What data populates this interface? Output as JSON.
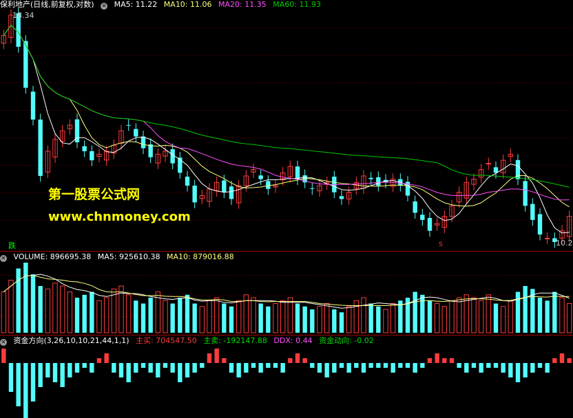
{
  "price_panel": {
    "title": "保利地产(日线,前复权,对数)",
    "ma5_label": "MA5: 11.22",
    "ma10_label": "MA10: 11.06",
    "ma20_label": "MA20: 11.35",
    "ma60_label": "MA60: 11.93",
    "high_label": "18.34",
    "low_label": "10.2",
    "die_label": "跌",
    "s_mark": "S"
  },
  "volume_panel": {
    "volume_label": "VOLUME: 896695.38",
    "ma5_label": "MA5: 925610.38",
    "ma10_label": "MA10: 879016.88"
  },
  "fund_panel": {
    "name_label": "资金方向(3,26,10,10,21,44,1,1)",
    "buy_label": "主买: 704547.50",
    "sell_label": "主卖: -192147.88",
    "ddx_label": "DDX: 0.44",
    "flow_label": "资金动向: -0.02"
  },
  "watermark": {
    "line1": "第一股票公式网",
    "line2": "www.chnmoney.com"
  },
  "colors": {
    "up": "#ff3c3c",
    "down": "#54fcfc",
    "ma5": "#ffffff",
    "ma10": "#ffff80",
    "ma20": "#ff50ff",
    "ma60": "#00cc00",
    "grid": "#7a0000",
    "watermark": "#ffff00"
  },
  "chart_data": {
    "type": "candlestick",
    "ohlc_close": [
      17.4,
      18.34,
      16.9,
      15.2,
      14.0,
      12.1,
      12.9,
      13.3,
      13.6,
      13.8,
      13.2,
      12.9,
      12.6,
      12.8,
      12.9,
      13.1,
      13.6,
      13.8,
      13.4,
      13.0,
      12.7,
      12.8,
      12.9,
      12.5,
      12.2,
      11.8,
      11.3,
      11.5,
      11.7,
      11.9,
      11.6,
      11.4,
      11.8,
      12.1,
      12.3,
      12.0,
      11.7,
      11.8,
      12.2,
      12.4,
      12.0,
      11.9,
      11.7,
      11.8,
      11.9,
      11.6,
      11.4,
      11.6,
      11.9,
      12.1,
      12.0,
      11.8,
      11.9,
      12.0,
      11.8,
      11.5,
      11.0,
      10.8,
      10.5,
      10.7,
      10.9,
      11.2,
      11.6,
      11.9,
      12.0,
      12.3,
      12.5,
      12.2,
      12.6,
      12.8,
      12.0,
      11.2,
      10.8,
      10.4,
      10.3,
      10.2,
      10.5,
      10.9
    ],
    "y_range": [
      10.2,
      18.34
    ],
    "volume": [
      70,
      90,
      110,
      120,
      100,
      80,
      75,
      85,
      80,
      70,
      60,
      65,
      70,
      55,
      60,
      75,
      80,
      65,
      55,
      50,
      60,
      70,
      55,
      50,
      60,
      65,
      50,
      45,
      55,
      60,
      50,
      45,
      55,
      65,
      60,
      50,
      45,
      50,
      55,
      60,
      50,
      45,
      40,
      45,
      50,
      40,
      35,
      45,
      55,
      60,
      50,
      45,
      40,
      50,
      55,
      60,
      70,
      65,
      55,
      50,
      45,
      55,
      60,
      65,
      60,
      55,
      65,
      50,
      45,
      55,
      70,
      80,
      75,
      60,
      55,
      70,
      60,
      50
    ],
    "fund_flow": [
      3,
      -6,
      -9,
      -12,
      -8,
      -5,
      -3,
      -4,
      -5,
      -3,
      -2,
      -1,
      -2,
      1,
      2,
      -2,
      -3,
      -4,
      -2,
      -1,
      -2,
      -3,
      -1,
      -2,
      -4,
      -3,
      -2,
      -1,
      2,
      3,
      1,
      -2,
      -3,
      -2,
      -1,
      -2,
      -1,
      -1,
      -2,
      1,
      2,
      1,
      -1,
      -2,
      -3,
      -2,
      -1,
      -2,
      -1,
      -2,
      -1,
      -1,
      -1,
      -2,
      -1,
      -1,
      -2,
      -1,
      1,
      2,
      1,
      1,
      -1,
      -2,
      -1,
      -2,
      -1,
      -1,
      -2,
      -3,
      -4,
      -3,
      -2,
      -1,
      -2,
      1,
      2,
      1
    ]
  }
}
